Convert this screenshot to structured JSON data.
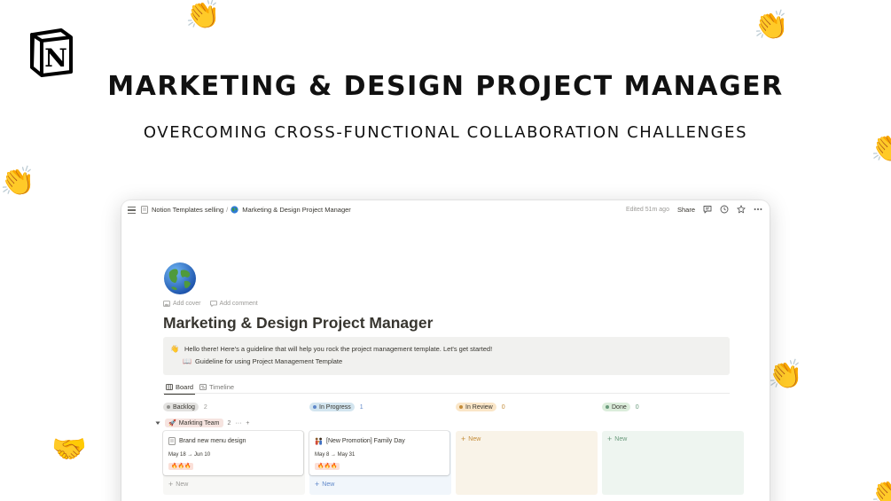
{
  "hero": {
    "title": "MARKETING & DESIGN PROJECT MANAGER",
    "subtitle": "OVERCOMING CROSS-FUNCTIONAL COLLABORATION CHALLENGES",
    "logo_letter": "N",
    "decorations": [
      "clapping-hands",
      "handshake"
    ]
  },
  "topbar": {
    "breadcrumb": [
      "Notion Templates selling",
      "Marketing & Design Project Manager"
    ],
    "separator": "/",
    "edited": "Edited 51m ago",
    "share": "Share",
    "icons": [
      "comment-icon",
      "clock-icon",
      "star-icon",
      "more-icon"
    ]
  },
  "page": {
    "title": "Marketing & Design Project Manager",
    "add_cover": "Add cover",
    "add_comment": "Add comment",
    "callout": {
      "emoji": "👋",
      "text": "Hello there! Here's a guideline that will help you rock the project management template. Let's get started!",
      "link_emoji": "📖",
      "link": "Guideline for using Project Management Template"
    }
  },
  "views": [
    {
      "label": "Board",
      "active": true
    },
    {
      "label": "Timeline",
      "active": false
    }
  ],
  "board": {
    "columns": [
      {
        "label": "Backlog",
        "count": "2",
        "bg": "#f3f2f1",
        "dot": "#91918e",
        "pill": "#e3e2e0"
      },
      {
        "label": "In Progress",
        "count": "1",
        "bg": "#f1f6fb",
        "dot": "#5e87c9",
        "pill": "#d3e5ef"
      },
      {
        "label": "In Review",
        "count": "0",
        "bg": "#f9f3e8",
        "dot": "#c48c39",
        "pill": "#fae6c8"
      },
      {
        "label": "Done",
        "count": "0",
        "bg": "#eef5f0",
        "dot": "#6a9a7c",
        "pill": "#dbeddb"
      }
    ],
    "group": {
      "emoji": "🚀",
      "label": "Markting Team",
      "count": "2",
      "more": "···",
      "add": "+"
    },
    "cards": [
      {
        "title": "Brand new menu design",
        "date": "May 18 → Jun 10",
        "tag": "🔥🔥🔥"
      },
      {
        "title": "[New Promotion] Family Day",
        "date": "May 8 → May 31",
        "tag": "🔥🔥🔥"
      }
    ],
    "new_label": "New"
  }
}
